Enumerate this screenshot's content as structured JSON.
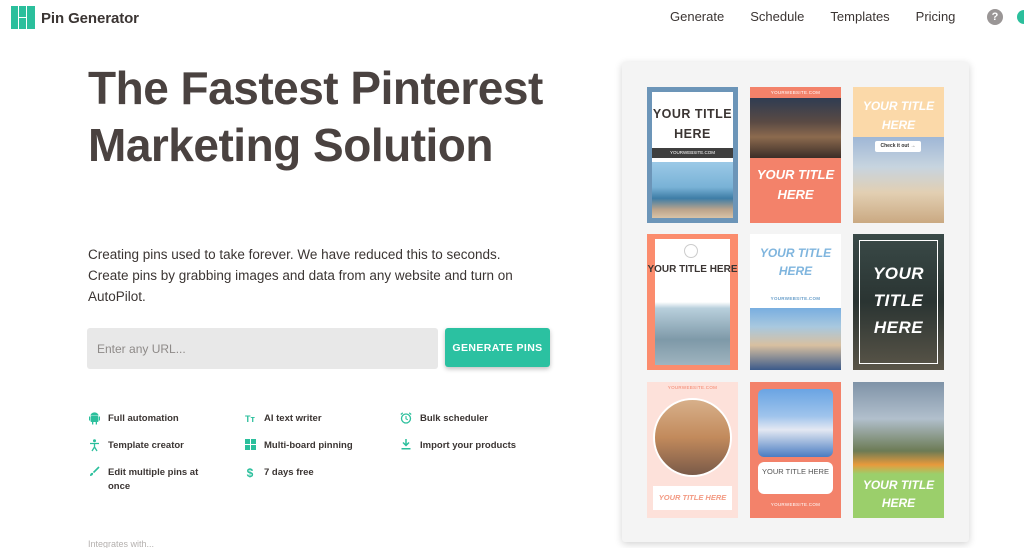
{
  "header": {
    "logo_text": "Pin Generator",
    "nav": [
      "Generate",
      "Schedule",
      "Templates",
      "Pricing"
    ],
    "help_glyph": "?"
  },
  "hero": {
    "title": "The Fastest Pinterest Marketing Solution",
    "subtitle": "Creating pins used to take forever. We have reduced this to seconds. Create pins by grabbing images and data from any website and turn on AutoPilot.",
    "url_placeholder": "Enter any URL...",
    "generate_label": "GENERATE PINS"
  },
  "features": [
    {
      "icon": "android-icon",
      "label": "Full automation"
    },
    {
      "icon": "text-icon",
      "label": "AI text writer"
    },
    {
      "icon": "alarm-clock-icon",
      "label": "Bulk scheduler"
    },
    {
      "icon": "accessibility-icon",
      "label": "Template creator"
    },
    {
      "icon": "grid-icon",
      "label": "Multi-board pinning"
    },
    {
      "icon": "download-icon",
      "label": "Import your products"
    },
    {
      "icon": "brush-icon",
      "label": "Edit multiple pins at once"
    },
    {
      "icon": "dollar-icon",
      "label": "7 days free"
    }
  ],
  "integrates_text": "Integrates with...",
  "pins": {
    "p1": {
      "title": "YOUR TITLE HERE",
      "site": "YOURWEBSITE.COM"
    },
    "p2": {
      "title": "YOUR TITLE HERE",
      "site": "YOURWEBSITE.COM"
    },
    "p3": {
      "title": "YOUR TITLE HERE",
      "chip": "Check it out →"
    },
    "p4": {
      "title": "YOUR TITLE HERE"
    },
    "p5": {
      "title": "YOUR TITLE HERE",
      "site": "YOURWEBSITE.COM"
    },
    "p6": {
      "title": "YOUR TITLE HERE"
    },
    "p7": {
      "title": "YOUR TITLE HERE",
      "site": "YOURWEBSITE.COM"
    },
    "p8": {
      "title": "YOUR TITLE HERE",
      "site": "YOURWEBSITE.COM"
    },
    "p9": {
      "title": "YOUR TITLE HERE"
    }
  },
  "colors": {
    "brand": "#2bbf9c",
    "heading": "#4a4240",
    "input_bg": "#e8e8e8"
  }
}
